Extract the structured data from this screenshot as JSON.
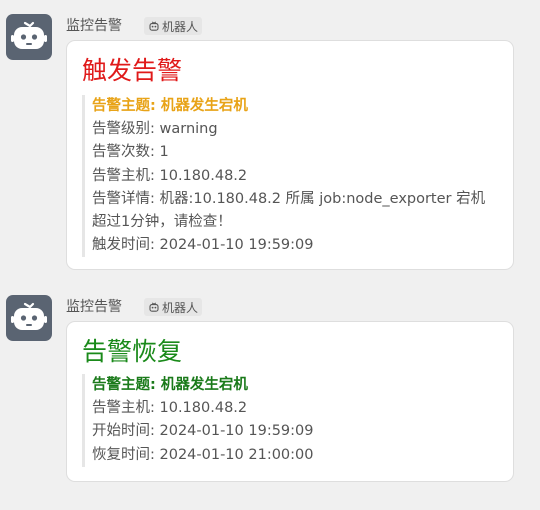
{
  "messages": [
    {
      "sender": "监控告警",
      "tag": "机器人",
      "title": "触发告警",
      "title_color": "#e01a1a",
      "subject": "告警主题: 机器发生宕机",
      "subject_color": "#e8a317",
      "lines": [
        "告警级别: warning",
        "告警次数: 1",
        "告警主机: 10.180.48.2",
        "告警详情: 机器:10.180.48.2 所属 job:node_exporter 宕机超过1分钟，请检查！",
        "触发时间: 2024-01-10 19:59:09"
      ]
    },
    {
      "sender": "监控告警",
      "tag": "机器人",
      "title": "告警恢复",
      "title_color": "#1a8a1a",
      "subject": "告警主题: 机器发生宕机",
      "subject_color": "#1a7a1a",
      "lines": [
        "告警主机: 10.180.48.2",
        "开始时间: 2024-01-10 19:59:09",
        "恢复时间: 2024-01-10 21:00:00"
      ]
    }
  ],
  "icons": {
    "avatar": "robot-icon",
    "tag": "robot-icon"
  }
}
